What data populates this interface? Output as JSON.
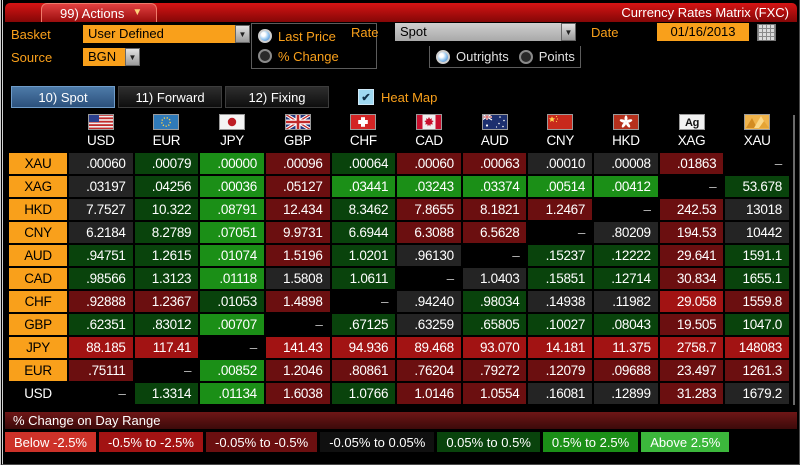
{
  "titlebar": {
    "actions_label": "99) Actions",
    "title": "Currency Rates Matrix (FXC)"
  },
  "controls": {
    "basket_label": "Basket",
    "basket_value": "User Defined",
    "source_label": "Source",
    "source_value": "BGN",
    "price_mode": [
      {
        "label": "Last Price",
        "selected": true
      },
      {
        "label": "% Change",
        "selected": false
      }
    ],
    "rate_label": "Rate",
    "rate_value": "Spot",
    "rate_mode": [
      {
        "label": "Outrights",
        "selected": true
      },
      {
        "label": "Points",
        "selected": false
      }
    ],
    "date_label": "Date",
    "date_value": "01/16/2013"
  },
  "tabs": [
    {
      "label": "10) Spot",
      "active": true
    },
    {
      "label": "11) Forward",
      "active": false
    },
    {
      "label": "12) Fixing",
      "active": false
    }
  ],
  "heatmap": {
    "label": "Heat Map",
    "checked": true,
    "checkmark": "✔"
  },
  "heat_colors": {
    "k": "#242424",
    "b": "#000000",
    "g1": "#09430c",
    "g2": "#1b8f17",
    "g3": "#3cb83c",
    "r1": "#6b0f10",
    "r2": "#a21313",
    "r3": "#cd3229"
  },
  "matrix": {
    "columns": [
      {
        "code": "USD",
        "flag": "us"
      },
      {
        "code": "EUR",
        "flag": "eu"
      },
      {
        "code": "JPY",
        "flag": "jp"
      },
      {
        "code": "GBP",
        "flag": "gb"
      },
      {
        "code": "CHF",
        "flag": "ch"
      },
      {
        "code": "CAD",
        "flag": "ca"
      },
      {
        "code": "AUD",
        "flag": "au"
      },
      {
        "code": "CNY",
        "flag": "cn"
      },
      {
        "code": "HKD",
        "flag": "hk"
      },
      {
        "code": "XAG",
        "flag": "ag"
      },
      {
        "code": "XAU",
        "flag": "xau"
      }
    ],
    "rows": [
      {
        "label": "XAU",
        "plain": false,
        "cells": [
          [
            ".00060",
            "k"
          ],
          [
            ".00079",
            "g1"
          ],
          [
            ".00000",
            "g2"
          ],
          [
            ".00096",
            "r1"
          ],
          [
            ".00064",
            "g1"
          ],
          [
            ".00060",
            "r1"
          ],
          [
            ".00063",
            "r1"
          ],
          [
            ".00010",
            "k"
          ],
          [
            ".00008",
            "k"
          ],
          [
            ".01863",
            "r1"
          ],
          [
            "–",
            "b"
          ]
        ]
      },
      {
        "label": "XAG",
        "plain": false,
        "cells": [
          [
            ".03197",
            "k"
          ],
          [
            ".04256",
            "g1"
          ],
          [
            ".00036",
            "g2"
          ],
          [
            ".05127",
            "r1"
          ],
          [
            ".03441",
            "g2"
          ],
          [
            ".03243",
            "g2"
          ],
          [
            ".03374",
            "g2"
          ],
          [
            ".00514",
            "g2"
          ],
          [
            ".00412",
            "g2"
          ],
          [
            "–",
            "b"
          ],
          [
            "53.678",
            "g1"
          ]
        ]
      },
      {
        "label": "HKD",
        "plain": false,
        "cells": [
          [
            "7.7527",
            "k"
          ],
          [
            "10.322",
            "g1"
          ],
          [
            ".08791",
            "g2"
          ],
          [
            "12.434",
            "r1"
          ],
          [
            "8.3462",
            "g1"
          ],
          [
            "7.8655",
            "r1"
          ],
          [
            "8.1821",
            "r1"
          ],
          [
            "1.2467",
            "r1"
          ],
          [
            "–",
            "b"
          ],
          [
            "242.53",
            "r1"
          ],
          [
            "13018",
            "k"
          ]
        ]
      },
      {
        "label": "CNY",
        "plain": false,
        "cells": [
          [
            "6.2184",
            "k"
          ],
          [
            "8.2789",
            "g1"
          ],
          [
            ".07051",
            "g2"
          ],
          [
            "9.9731",
            "r1"
          ],
          [
            "6.6944",
            "g1"
          ],
          [
            "6.3088",
            "r1"
          ],
          [
            "6.5628",
            "r1"
          ],
          [
            "–",
            "b"
          ],
          [
            ".80209",
            "k"
          ],
          [
            "194.53",
            "r1"
          ],
          [
            "10442",
            "k"
          ]
        ]
      },
      {
        "label": "AUD",
        "plain": false,
        "cells": [
          [
            ".94751",
            "g1"
          ],
          [
            "1.2615",
            "g1"
          ],
          [
            ".01074",
            "g2"
          ],
          [
            "1.5196",
            "r1"
          ],
          [
            "1.0201",
            "g1"
          ],
          [
            ".96130",
            "k"
          ],
          [
            "–",
            "b"
          ],
          [
            ".15237",
            "g1"
          ],
          [
            ".12222",
            "g1"
          ],
          [
            "29.641",
            "r1"
          ],
          [
            "1591.1",
            "g1"
          ]
        ]
      },
      {
        "label": "CAD",
        "plain": false,
        "cells": [
          [
            ".98566",
            "g1"
          ],
          [
            "1.3123",
            "g1"
          ],
          [
            ".01118",
            "g2"
          ],
          [
            "1.5808",
            "k"
          ],
          [
            "1.0611",
            "g1"
          ],
          [
            "–",
            "b"
          ],
          [
            "1.0403",
            "k"
          ],
          [
            ".15851",
            "g1"
          ],
          [
            ".12714",
            "g1"
          ],
          [
            "30.834",
            "r1"
          ],
          [
            "1655.1",
            "g1"
          ]
        ]
      },
      {
        "label": "CHF",
        "plain": false,
        "cells": [
          [
            ".92888",
            "r1"
          ],
          [
            "1.2367",
            "r1"
          ],
          [
            ".01053",
            "g1"
          ],
          [
            "1.4898",
            "r1"
          ],
          [
            "–",
            "b"
          ],
          [
            ".94240",
            "k"
          ],
          [
            ".98034",
            "g1"
          ],
          [
            ".14938",
            "k"
          ],
          [
            ".11982",
            "k"
          ],
          [
            "29.058",
            "r2"
          ],
          [
            "1559.8",
            "r1"
          ]
        ]
      },
      {
        "label": "GBP",
        "plain": false,
        "cells": [
          [
            ".62351",
            "g1"
          ],
          [
            ".83012",
            "g1"
          ],
          [
            ".00707",
            "g2"
          ],
          [
            "–",
            "b"
          ],
          [
            ".67125",
            "g1"
          ],
          [
            ".63259",
            "k"
          ],
          [
            ".65805",
            "g1"
          ],
          [
            ".10027",
            "g1"
          ],
          [
            ".08043",
            "g1"
          ],
          [
            "19.505",
            "r1"
          ],
          [
            "1047.0",
            "g1"
          ]
        ]
      },
      {
        "label": "JPY",
        "plain": false,
        "cells": [
          [
            "88.185",
            "r2"
          ],
          [
            "117.41",
            "r2"
          ],
          [
            "–",
            "b"
          ],
          [
            "141.43",
            "r2"
          ],
          [
            "94.936",
            "r2"
          ],
          [
            "89.468",
            "r2"
          ],
          [
            "93.070",
            "r2"
          ],
          [
            "14.181",
            "r2"
          ],
          [
            "11.375",
            "r2"
          ],
          [
            "2758.7",
            "r2"
          ],
          [
            "148083",
            "r2"
          ]
        ]
      },
      {
        "label": "EUR",
        "plain": false,
        "cells": [
          [
            ".75111",
            "r1"
          ],
          [
            "–",
            "b"
          ],
          [
            ".00852",
            "g2"
          ],
          [
            "1.2046",
            "r1"
          ],
          [
            ".80861",
            "r1"
          ],
          [
            ".76204",
            "r1"
          ],
          [
            ".79272",
            "r1"
          ],
          [
            ".12079",
            "r1"
          ],
          [
            ".09688",
            "r1"
          ],
          [
            "23.497",
            "r1"
          ],
          [
            "1261.3",
            "r1"
          ]
        ]
      },
      {
        "label": "USD",
        "plain": true,
        "cells": [
          [
            "–",
            "b"
          ],
          [
            "1.3314",
            "g1"
          ],
          [
            ".01134",
            "g2"
          ],
          [
            "1.6038",
            "r1"
          ],
          [
            "1.0766",
            "g1"
          ],
          [
            "1.0146",
            "r1"
          ],
          [
            "1.0554",
            "r1"
          ],
          [
            ".16081",
            "k"
          ],
          [
            ".12899",
            "k"
          ],
          [
            "31.283",
            "r1"
          ],
          [
            "1679.2",
            "k"
          ]
        ]
      }
    ]
  },
  "legend": {
    "title": "% Change on Day Range",
    "buckets": [
      {
        "label": "Below -2.5%",
        "c": "r3"
      },
      {
        "label": "-0.5% to -2.5%",
        "c": "r2"
      },
      {
        "label": "-0.05% to -0.5%",
        "c": "r1"
      },
      {
        "label": "-0.05% to 0.05%",
        "c": "b"
      },
      {
        "label": "0.05% to 0.5%",
        "c": "g1"
      },
      {
        "label": "0.5% to 2.5%",
        "c": "g2"
      },
      {
        "label": "Above 2.5%",
        "c": "g3"
      }
    ]
  }
}
